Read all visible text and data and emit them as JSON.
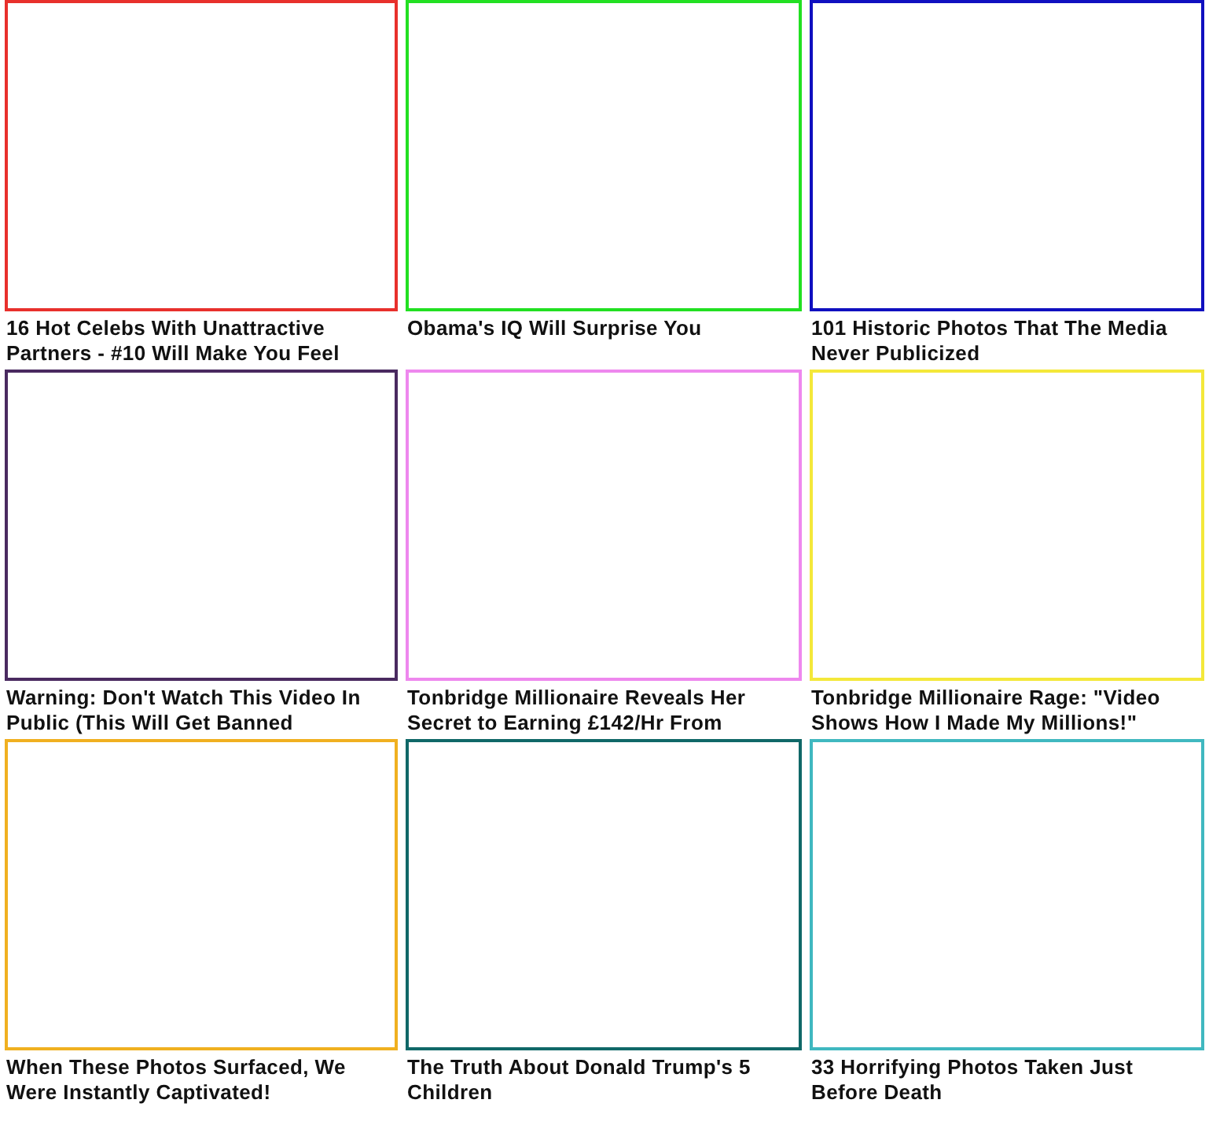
{
  "articles": [
    {
      "title": "16 Hot Celebs With Unattractive Partners - #10 Will Make You Feel",
      "color": "#e8302c"
    },
    {
      "title": "Obama's IQ Will Surprise You",
      "color": "#22e022"
    },
    {
      "title": "101 Historic Photos That The Media Never Publicized",
      "color": "#1010c0"
    },
    {
      "title": "Warning: Don't Watch This Video In Public (This Will Get Banned",
      "color": "#4a2a60"
    },
    {
      "title": "Tonbridge Millionaire Reveals Her Secret to Earning £142/Hr From",
      "color": "#ee88ee"
    },
    {
      "title": "Tonbridge Millionaire Rage: \"Video Shows How I Made My Millions!\"",
      "color": "#f4e83a"
    },
    {
      "title": "When These Photos Surfaced, We Were Instantly Captivated!",
      "color": "#f0b020"
    },
    {
      "title": "The Truth About Donald Trump's 5 Children",
      "color": "#106868"
    },
    {
      "title": "33 Horrifying Photos Taken Just Before Death",
      "color": "#40b8c0"
    }
  ]
}
